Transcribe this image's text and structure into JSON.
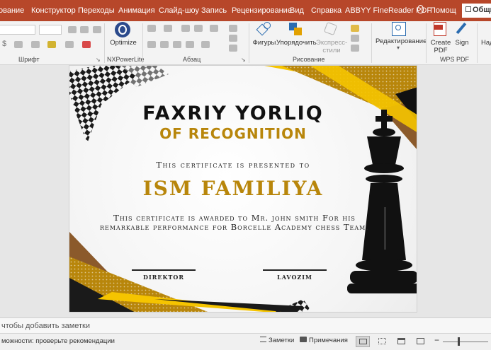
{
  "menubar": {
    "tabs": [
      "ование",
      "Конструктор",
      "Переходы",
      "Анимация",
      "Слайд-шоу",
      "Запись",
      "Рецензирование",
      "Вид",
      "Справка",
      "ABBYY FineReader PDF",
      "Помощ"
    ],
    "share": "Общи",
    "color": "#b7472a"
  },
  "ribbon": {
    "groups": {
      "font": "Шрифт",
      "nxpowerlite": "NXPowerLite",
      "paragraph": "Абзац",
      "drawing": "Рисование",
      "wpspdf": "WPS PDF"
    },
    "font_size_icon": "$",
    "buttons": {
      "optimize": "Optimize",
      "shapes": "Фигуры",
      "arrange": "Упорядочить",
      "express": "Экспресс-",
      "styles": "стили",
      "editing": "Редактирование",
      "create_pdf_1": "Create",
      "create_pdf_2": "PDF",
      "sign": "Sign",
      "right_cut": "Над"
    }
  },
  "slide": {
    "title_line1": "FAXRIY YORLIQ",
    "title_line2": "OF RECOGNITION",
    "presented": "This certificate is presented to",
    "name": "ISM FAMILIYA",
    "awarded": "This certificate is awarded to Mr. john smith For his remarkable performance for Borcelle Academy chess Team.",
    "sig_left": "DIREKTOR",
    "sig_right": "LAVOZIM",
    "accent_gold": "#b8860b",
    "accent_yellow": "#f5c400",
    "accent_brown": "#8b5a2b"
  },
  "notes": {
    "placeholder": "чтобы добавить заметки"
  },
  "statusbar": {
    "accessibility": "можности: проверьте рекомендации",
    "notes_btn": "Заметки",
    "comments_btn": "Примечания"
  }
}
